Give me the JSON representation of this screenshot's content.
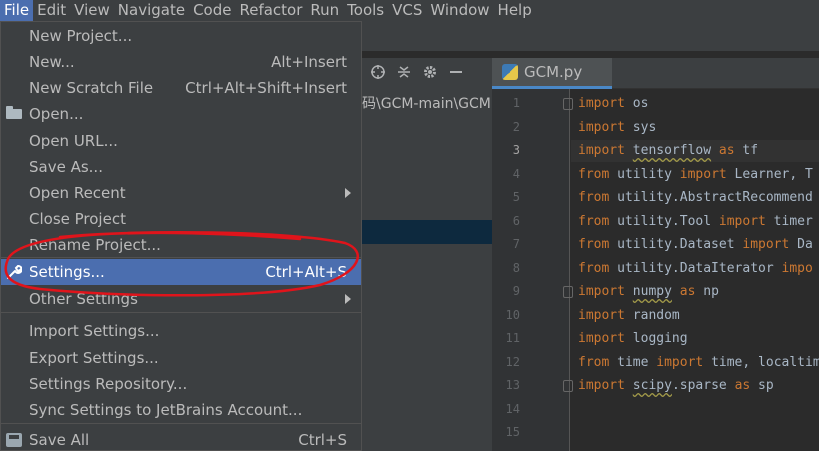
{
  "menubar": {
    "items": [
      "File",
      "Edit",
      "View",
      "Navigate",
      "Code",
      "Refactor",
      "Run",
      "Tools",
      "VCS",
      "Window",
      "Help"
    ],
    "active": "File"
  },
  "toolbar": {
    "icons": [
      "crosshair-icon",
      "collapse-icon",
      "gear-icon",
      "minimize-icon"
    ]
  },
  "project": {
    "path": "码\\GCM-main\\GCM"
  },
  "editor": {
    "tab": {
      "label": "GCM.py",
      "icon": "python-file-icon"
    },
    "current_line": 3,
    "line_numbers": [
      "1",
      "2",
      "3",
      "4",
      "5",
      "6",
      "7",
      "8",
      "9",
      "10",
      "11",
      "12",
      "13",
      "14",
      "15"
    ],
    "code": [
      [
        {
          "t": "import",
          "k": true
        },
        {
          "t": " os"
        }
      ],
      [
        {
          "t": "import",
          "k": true
        },
        {
          "t": " sys"
        }
      ],
      [
        {
          "t": "import",
          "k": true
        },
        {
          "t": " "
        },
        {
          "t": "tensorflow",
          "w": true
        },
        {
          "t": " "
        },
        {
          "t": "as",
          "k": true
        },
        {
          "t": " tf"
        }
      ],
      [
        {
          "t": "from",
          "k": true
        },
        {
          "t": " utility "
        },
        {
          "t": "import",
          "k": true
        },
        {
          "t": " Learner, T"
        }
      ],
      [
        {
          "t": "from",
          "k": true
        },
        {
          "t": " utility.AbstractRecommend"
        }
      ],
      [
        {
          "t": "from",
          "k": true
        },
        {
          "t": " utility.Tool "
        },
        {
          "t": "import",
          "k": true
        },
        {
          "t": " timer"
        }
      ],
      [
        {
          "t": "from",
          "k": true
        },
        {
          "t": " utility.Dataset "
        },
        {
          "t": "import",
          "k": true
        },
        {
          "t": " Da"
        }
      ],
      [
        {
          "t": "from",
          "k": true
        },
        {
          "t": " utility.DataIterator "
        },
        {
          "t": "impo",
          "k": true
        }
      ],
      [
        {
          "t": "import",
          "k": true
        },
        {
          "t": " "
        },
        {
          "t": "numpy",
          "w": true
        },
        {
          "t": " "
        },
        {
          "t": "as",
          "k": true
        },
        {
          "t": " np"
        }
      ],
      [
        {
          "t": "import",
          "k": true
        },
        {
          "t": " random"
        }
      ],
      [
        {
          "t": "import",
          "k": true
        },
        {
          "t": " logging"
        }
      ],
      [
        {
          "t": "from",
          "k": true
        },
        {
          "t": " time "
        },
        {
          "t": "import",
          "k": true
        },
        {
          "t": " time, localtim"
        }
      ],
      [
        {
          "t": "import",
          "k": true
        },
        {
          "t": " "
        },
        {
          "t": "scipy",
          "w": true
        },
        {
          "t": ".sparse "
        },
        {
          "t": "as",
          "k": true
        },
        {
          "t": " sp"
        }
      ],
      [],
      []
    ]
  },
  "file_menu": {
    "items": [
      {
        "label": "New Project...",
        "shortcut": "",
        "submenu": false
      },
      {
        "label": "New...",
        "shortcut": "Alt+Insert",
        "submenu": false
      },
      {
        "label": "New Scratch File",
        "shortcut": "Ctrl+Alt+Shift+Insert",
        "submenu": false
      },
      {
        "label": "Open...",
        "shortcut": "",
        "submenu": false,
        "icon": "folder-icon"
      },
      {
        "label": "Open URL...",
        "shortcut": "",
        "submenu": false
      },
      {
        "label": "Save As...",
        "shortcut": "",
        "submenu": false
      },
      {
        "label": "Open Recent",
        "shortcut": "",
        "submenu": true
      },
      {
        "label": "Close Project",
        "shortcut": "",
        "submenu": false
      },
      {
        "label": "Rename Project...",
        "shortcut": "",
        "submenu": false
      },
      {
        "label": "Settings...",
        "shortcut": "Ctrl+Alt+S",
        "submenu": false,
        "icon": "wrench-icon",
        "selected": true
      },
      {
        "label": "Other Settings",
        "shortcut": "",
        "submenu": true
      },
      {
        "label": "Import Settings...",
        "shortcut": "",
        "submenu": false
      },
      {
        "label": "Export Settings...",
        "shortcut": "",
        "submenu": false
      },
      {
        "label": "Settings Repository...",
        "shortcut": "",
        "submenu": false
      },
      {
        "label": "Sync Settings to JetBrains Account...",
        "shortcut": "",
        "submenu": false
      },
      {
        "label": "Save All",
        "shortcut": "Ctrl+S",
        "submenu": false,
        "icon": "save-disk-icon"
      }
    ]
  },
  "annotation": {
    "color": "#e0141b"
  }
}
